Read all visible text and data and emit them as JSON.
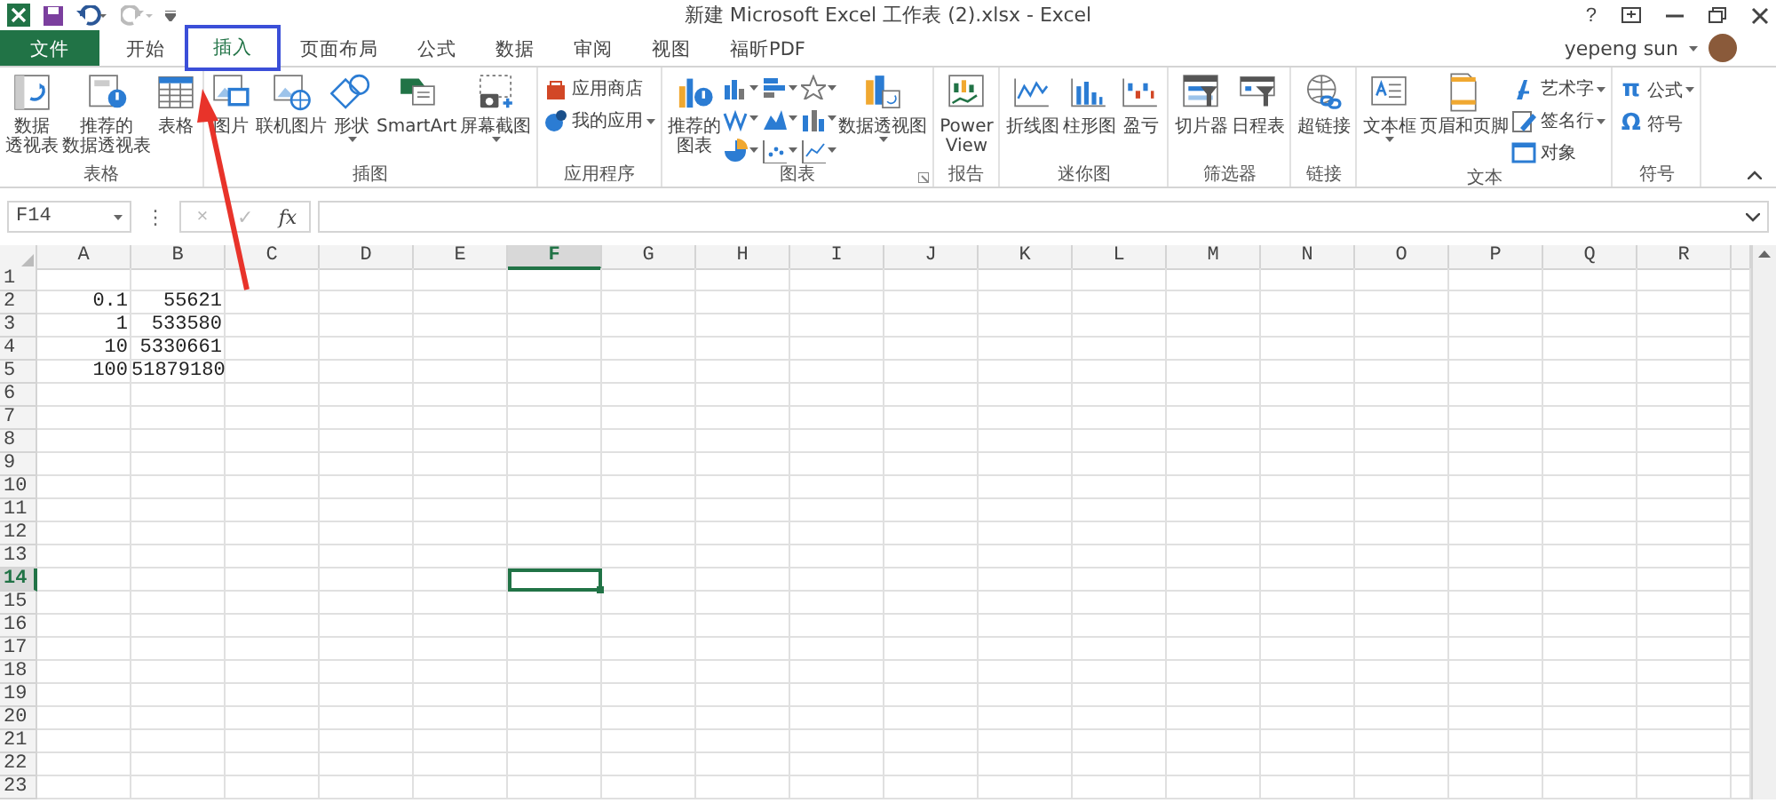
{
  "window": {
    "title": "新建 Microsoft Excel 工作表 (2).xlsx - Excel",
    "help": "?",
    "user": "yepeng sun"
  },
  "tabs": [
    {
      "label": "文件",
      "kind": "file",
      "selected": false
    },
    {
      "label": "开始",
      "kind": "tab",
      "selected": false
    },
    {
      "label": "插入",
      "kind": "tab",
      "selected": true
    },
    {
      "label": "页面布局",
      "kind": "tab",
      "selected": false
    },
    {
      "label": "公式",
      "kind": "tab",
      "selected": false
    },
    {
      "label": "数据",
      "kind": "tab",
      "selected": false
    },
    {
      "label": "审阅",
      "kind": "tab",
      "selected": false
    },
    {
      "label": "视图",
      "kind": "tab",
      "selected": false
    },
    {
      "label": "福昕PDF",
      "kind": "tab",
      "selected": false
    }
  ],
  "ribbon": [
    {
      "title": "表格",
      "items": [
        {
          "kind": "large",
          "lines": [
            "数据",
            "透视表"
          ]
        },
        {
          "kind": "large",
          "lines": [
            "推荐的",
            "数据透视表"
          ]
        },
        {
          "kind": "large",
          "lines": [
            "表格"
          ]
        }
      ]
    },
    {
      "title": "插图",
      "items": [
        {
          "kind": "large",
          "lines": [
            "图片"
          ]
        },
        {
          "kind": "large",
          "lines": [
            "联机图片"
          ]
        },
        {
          "kind": "large",
          "lines": [
            "形状"
          ],
          "dropdown": true
        },
        {
          "kind": "large",
          "lines": [
            "SmartArt"
          ]
        },
        {
          "kind": "large",
          "lines": [
            "屏幕截图"
          ],
          "dropdown": true
        }
      ]
    },
    {
      "title": "应用程序",
      "items": [
        {
          "kind": "small-stack",
          "entries": [
            {
              "label": "应用商店"
            },
            {
              "label": "我的应用",
              "dropdown": true
            }
          ]
        }
      ]
    },
    {
      "title": "图表",
      "launcher": true,
      "items": [
        {
          "kind": "large",
          "lines": [
            "推荐的",
            "图表"
          ]
        },
        {
          "kind": "chart-gallery"
        },
        {
          "kind": "large",
          "lines": [
            "数据透视图"
          ],
          "dropdown": true
        }
      ]
    },
    {
      "title": "报告",
      "items": [
        {
          "kind": "large",
          "lines": [
            "Power",
            "View"
          ]
        }
      ]
    },
    {
      "title": "迷你图",
      "items": [
        {
          "kind": "large",
          "lines": [
            "折线图"
          ]
        },
        {
          "kind": "large",
          "lines": [
            "柱形图"
          ]
        },
        {
          "kind": "large",
          "lines": [
            "盈亏"
          ]
        }
      ]
    },
    {
      "title": "筛选器",
      "items": [
        {
          "kind": "large",
          "lines": [
            "切片器"
          ]
        },
        {
          "kind": "large",
          "lines": [
            "日程表"
          ]
        }
      ]
    },
    {
      "title": "链接",
      "items": [
        {
          "kind": "large",
          "lines": [
            "超链接"
          ]
        }
      ]
    },
    {
      "title": "文本",
      "items": [
        {
          "kind": "large",
          "lines": [
            "文本框"
          ],
          "dropdown": true
        },
        {
          "kind": "large",
          "lines": [
            "页眉和页脚"
          ]
        },
        {
          "kind": "small-stack",
          "entries": [
            {
              "label": "艺术字",
              "dropdown": true
            },
            {
              "label": "签名行",
              "dropdown": true
            },
            {
              "label": "对象"
            }
          ]
        }
      ]
    },
    {
      "title": "符号",
      "items": [
        {
          "kind": "small-stack",
          "entries": [
            {
              "label": "公式",
              "icon_char": "π",
              "dropdown": true
            },
            {
              "label": "符号",
              "icon_char": "Ω"
            }
          ]
        }
      ]
    }
  ],
  "formula_bar": {
    "name_box": "F14",
    "separator": "⋮",
    "buttons": [
      {
        "label": "×",
        "disabled": true
      },
      {
        "label": "✓",
        "disabled": true
      },
      {
        "label": "fx",
        "disabled": false
      }
    ]
  },
  "columns": [
    {
      "label": "A",
      "selected": false
    },
    {
      "label": "B",
      "selected": false
    },
    {
      "label": "C",
      "selected": false
    },
    {
      "label": "D",
      "selected": false
    },
    {
      "label": "E",
      "selected": false
    },
    {
      "label": "F",
      "selected": true
    },
    {
      "label": "G",
      "selected": false
    },
    {
      "label": "H",
      "selected": false
    },
    {
      "label": "I",
      "selected": false
    },
    {
      "label": "J",
      "selected": false
    },
    {
      "label": "K",
      "selected": false
    },
    {
      "label": "L",
      "selected": false
    },
    {
      "label": "M",
      "selected": false
    },
    {
      "label": "N",
      "selected": false
    },
    {
      "label": "O",
      "selected": false
    },
    {
      "label": "P",
      "selected": false
    },
    {
      "label": "Q",
      "selected": false
    },
    {
      "label": "R",
      "selected": false
    }
  ],
  "rows": [
    {
      "label": "1",
      "selected": false
    },
    {
      "label": "2",
      "selected": false,
      "cells": [
        "0.1",
        "55621"
      ]
    },
    {
      "label": "3",
      "selected": false,
      "cells": [
        "1",
        "533580"
      ]
    },
    {
      "label": "4",
      "selected": false,
      "cells": [
        "10",
        "5330661"
      ]
    },
    {
      "label": "5",
      "selected": false,
      "cells": [
        "100",
        "51879180"
      ]
    },
    {
      "label": "6",
      "selected": false
    },
    {
      "label": "7",
      "selected": false
    },
    {
      "label": "8",
      "selected": false
    },
    {
      "label": "9",
      "selected": false
    },
    {
      "label": "10",
      "selected": false
    },
    {
      "label": "11",
      "selected": false
    },
    {
      "label": "12",
      "selected": false
    },
    {
      "label": "13",
      "selected": false
    },
    {
      "label": "14",
      "selected": true
    },
    {
      "label": "15",
      "selected": false
    },
    {
      "label": "16",
      "selected": false
    },
    {
      "label": "17",
      "selected": false
    },
    {
      "label": "18",
      "selected": false
    },
    {
      "label": "19",
      "selected": false
    },
    {
      "label": "20",
      "selected": false
    },
    {
      "label": "21",
      "selected": false
    },
    {
      "label": "22",
      "selected": false
    },
    {
      "label": "23",
      "selected": false
    }
  ],
  "annotations": {
    "highlight_box": true,
    "arrow": true
  }
}
